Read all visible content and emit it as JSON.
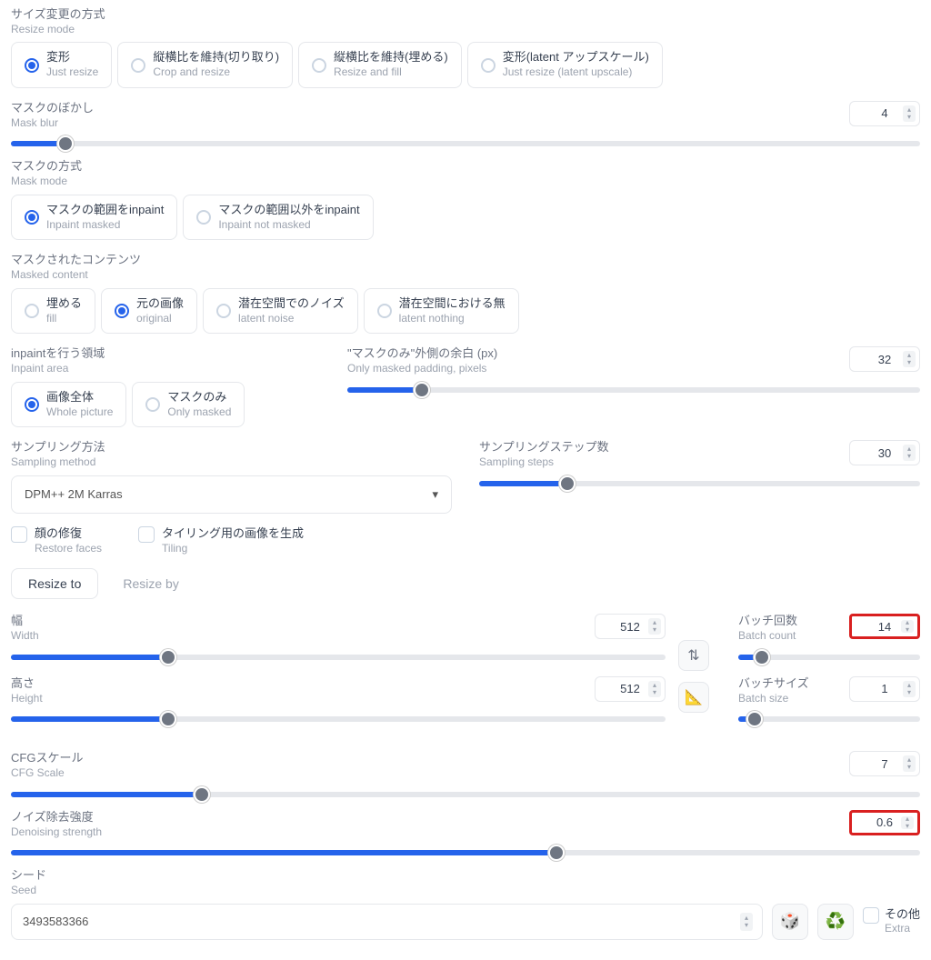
{
  "resize_mode": {
    "label_jp": "サイズ変更の方式",
    "label_en": "Resize mode",
    "options": [
      {
        "jp": "変形",
        "en": "Just resize",
        "selected": true
      },
      {
        "jp": "縦横比を維持(切り取り)",
        "en": "Crop and resize",
        "selected": false
      },
      {
        "jp": "縦横比を維持(埋める)",
        "en": "Resize and fill",
        "selected": false
      },
      {
        "jp": "変形(latent アップスケール)",
        "en": "Just resize (latent upscale)",
        "selected": false
      }
    ]
  },
  "mask_blur": {
    "label_jp": "マスクのぼかし",
    "label_en": "Mask blur",
    "value": "4",
    "fill_pct": 6
  },
  "mask_mode": {
    "label_jp": "マスクの方式",
    "label_en": "Mask mode",
    "options": [
      {
        "jp": "マスクの範囲をinpaint",
        "en": "Inpaint masked",
        "selected": true
      },
      {
        "jp": "マスクの範囲以外をinpaint",
        "en": "Inpaint not masked",
        "selected": false
      }
    ]
  },
  "masked_content": {
    "label_jp": "マスクされたコンテンツ",
    "label_en": "Masked content",
    "options": [
      {
        "jp": "埋める",
        "en": "fill",
        "selected": false
      },
      {
        "jp": "元の画像",
        "en": "original",
        "selected": true
      },
      {
        "jp": "潜在空間でのノイズ",
        "en": "latent noise",
        "selected": false
      },
      {
        "jp": "潜在空間における無",
        "en": "latent nothing",
        "selected": false
      }
    ]
  },
  "inpaint_area": {
    "label_jp": "inpaintを行う領域",
    "label_en": "Inpaint area",
    "options": [
      {
        "jp": "画像全体",
        "en": "Whole picture",
        "selected": true
      },
      {
        "jp": "マスクのみ",
        "en": "Only masked",
        "selected": false
      }
    ]
  },
  "padding": {
    "label_jp": "\"マスクのみ\"外側の余白 (px)",
    "label_en": "Only masked padding, pixels",
    "value": "32",
    "fill_pct": 13
  },
  "sampling_method": {
    "label_jp": "サンプリング方法",
    "label_en": "Sampling method",
    "value": "DPM++ 2M Karras"
  },
  "sampling_steps": {
    "label_jp": "サンプリングステップ数",
    "label_en": "Sampling steps",
    "value": "30",
    "fill_pct": 20
  },
  "restore_faces": {
    "label_jp": "顔の修復",
    "label_en": "Restore faces"
  },
  "tiling": {
    "label_jp": "タイリング用の画像を生成",
    "label_en": "Tiling"
  },
  "tabs": {
    "resize_to": "Resize to",
    "resize_by": "Resize by"
  },
  "width": {
    "label_jp": "幅",
    "label_en": "Width",
    "value": "512",
    "fill_pct": 24
  },
  "height": {
    "label_jp": "高さ",
    "label_en": "Height",
    "value": "512",
    "fill_pct": 24
  },
  "batch_count": {
    "label_jp": "バッチ回数",
    "label_en": "Batch count",
    "value": "14",
    "fill_pct": 13
  },
  "batch_size": {
    "label_jp": "バッチサイズ",
    "label_en": "Batch size",
    "value": "1",
    "fill_pct": 9
  },
  "cfg": {
    "label_jp": "CFGスケール",
    "label_en": "CFG Scale",
    "value": "7",
    "fill_pct": 21
  },
  "denoise": {
    "label_jp": "ノイズ除去強度",
    "label_en": "Denoising strength",
    "value": "0.6",
    "fill_pct": 60
  },
  "seed": {
    "label_jp": "シード",
    "label_en": "Seed",
    "value": "3493583366"
  },
  "extra": {
    "label_jp": "その他",
    "label_en": "Extra"
  },
  "icons": {
    "dice": "🎲",
    "recycle": "♻️",
    "swap": "⇅",
    "ruler": "📐",
    "chevron": "▾"
  }
}
